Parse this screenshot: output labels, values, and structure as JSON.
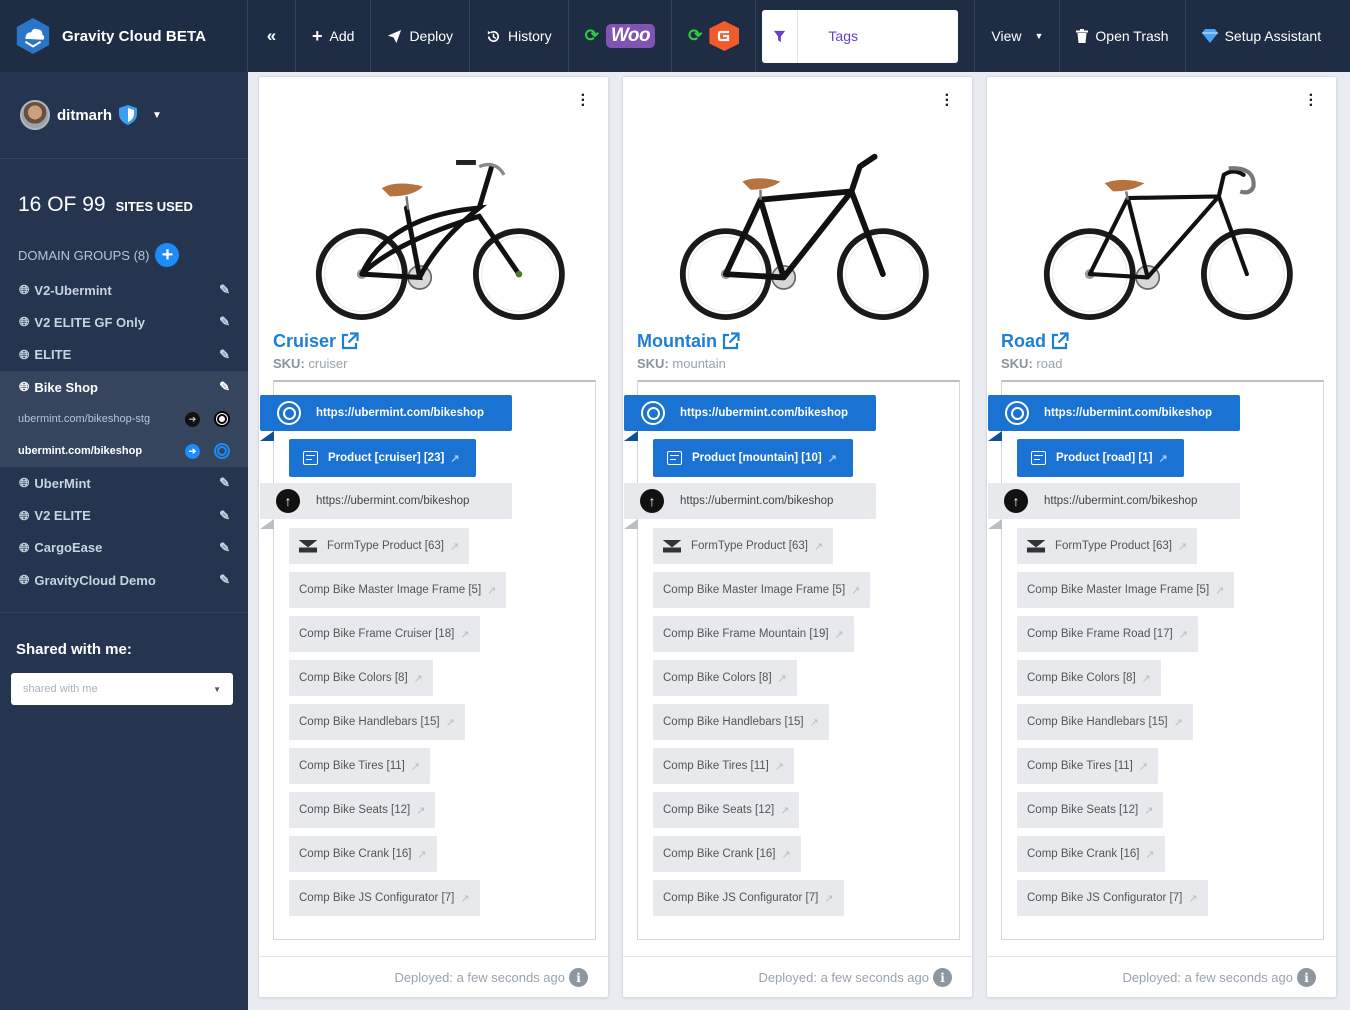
{
  "app": {
    "title": "Gravity Cloud BETA"
  },
  "toolbar": {
    "collapse": "«",
    "add": "Add",
    "deploy": "Deploy",
    "history": "History",
    "woo": "Woo",
    "tags": "Tags",
    "view": "View",
    "open_trash": "Open Trash",
    "setup_assistant": "Setup Assistant"
  },
  "sidebar": {
    "username": "ditmarh",
    "sites_count": "16 OF 99",
    "sites_label": "SITES USED",
    "domain_groups": "DOMAIN GROUPS (8)",
    "groups_before": [
      "V2-Ubermint",
      "V2 ELITE GF Only",
      "ELITE"
    ],
    "active_group": "Bike Shop",
    "active_urls": [
      "ubermint.com/bikeshop-stg",
      "ubermint.com/bikeshop"
    ],
    "groups_after": [
      "UberMint",
      "V2 ELITE",
      "CargoEase",
      "GravityCloud Demo"
    ],
    "shared_title": "Shared with me:",
    "shared_placeholder": "shared with me"
  },
  "common": {
    "primary_url": "https://ubermint.com/bikeshop",
    "secondary_url": "https://ubermint.com/bikeshop",
    "form": "FormType Product [63]",
    "sku_label": "SKU:",
    "deployed": "Deployed: a few seconds ago"
  },
  "cards": [
    {
      "title": "Cruiser",
      "sku": "cruiser",
      "product": "Product [cruiser] [23]",
      "tags": [
        "Comp Bike Master Image Frame [5]",
        "Comp Bike Frame Cruiser [18]",
        "Comp Bike Colors [8]",
        "Comp Bike Handlebars [15]",
        "Comp Bike Tires [11]",
        "Comp Bike Seats [12]",
        "Comp Bike Crank [16]",
        "Comp Bike JS Configurator [7]"
      ]
    },
    {
      "title": "Mountain",
      "sku": "mountain",
      "product": "Product [mountain] [10]",
      "tags": [
        "Comp Bike Master Image Frame [5]",
        "Comp Bike Frame Mountain [19]",
        "Comp Bike Colors [8]",
        "Comp Bike Handlebars [15]",
        "Comp Bike Tires [11]",
        "Comp Bike Seats [12]",
        "Comp Bike Crank [16]",
        "Comp Bike JS Configurator [7]"
      ]
    },
    {
      "title": "Road",
      "sku": "road",
      "product": "Product [road] [1]",
      "tags": [
        "Comp Bike Master Image Frame [5]",
        "Comp Bike Frame Road [17]",
        "Comp Bike Colors [8]",
        "Comp Bike Handlebars [15]",
        "Comp Bike Tires [11]",
        "Comp Bike Seats [12]",
        "Comp Bike Crank [16]",
        "Comp Bike JS Configurator [7]"
      ]
    }
  ],
  "colors": {
    "topbar": "#1f2d44",
    "sidebar": "#253550",
    "accent": "#1a73d2",
    "title": "#1d7fd6",
    "woo": "#7f54b3",
    "gravity_forms": "#f15a2b",
    "tags_filter": "#6a3fc8"
  }
}
